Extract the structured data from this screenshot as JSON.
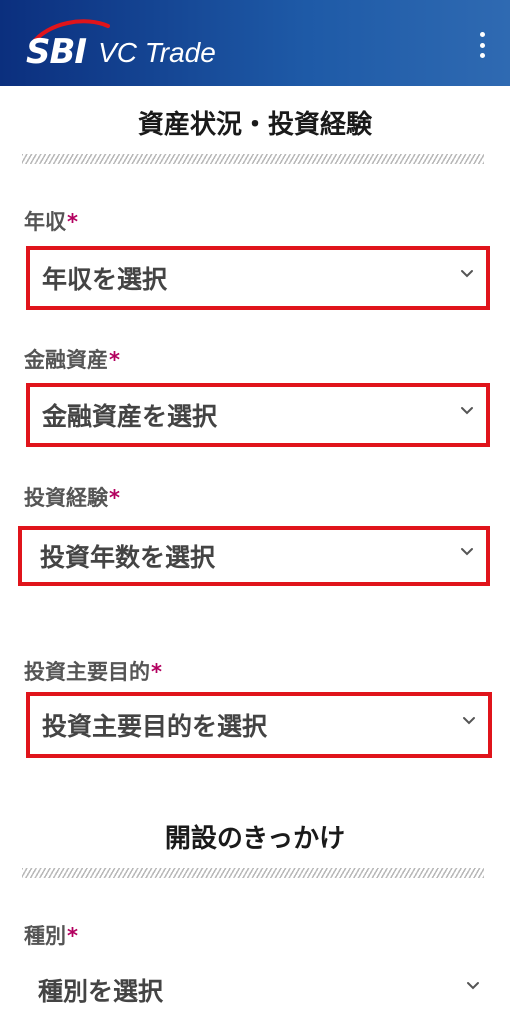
{
  "header": {
    "logo_main": "SBI",
    "logo_sub": "VC Trade",
    "menu_icon": "more-vertical-icon"
  },
  "section1": {
    "title": "資産状況・投資経験"
  },
  "fields": {
    "income": {
      "label": "年収",
      "required": "*",
      "placeholder": "年収を選択"
    },
    "assets": {
      "label": "金融資産",
      "required": "*",
      "placeholder": "金融資産を選択"
    },
    "experience": {
      "label": "投資経験",
      "required": "*",
      "placeholder": "投資年数を選択"
    },
    "purpose": {
      "label": "投資主要目的",
      "required": "*",
      "placeholder": "投資主要目的を選択"
    },
    "type": {
      "label": "種別",
      "required": "*",
      "placeholder": "種別を選択"
    }
  },
  "section2": {
    "title": "開設のきっかけ"
  },
  "colors": {
    "header_start": "#0b2f7e",
    "header_end": "#2f6ab2",
    "highlight_border": "#e0141b",
    "required_mark": "#b3005f"
  }
}
